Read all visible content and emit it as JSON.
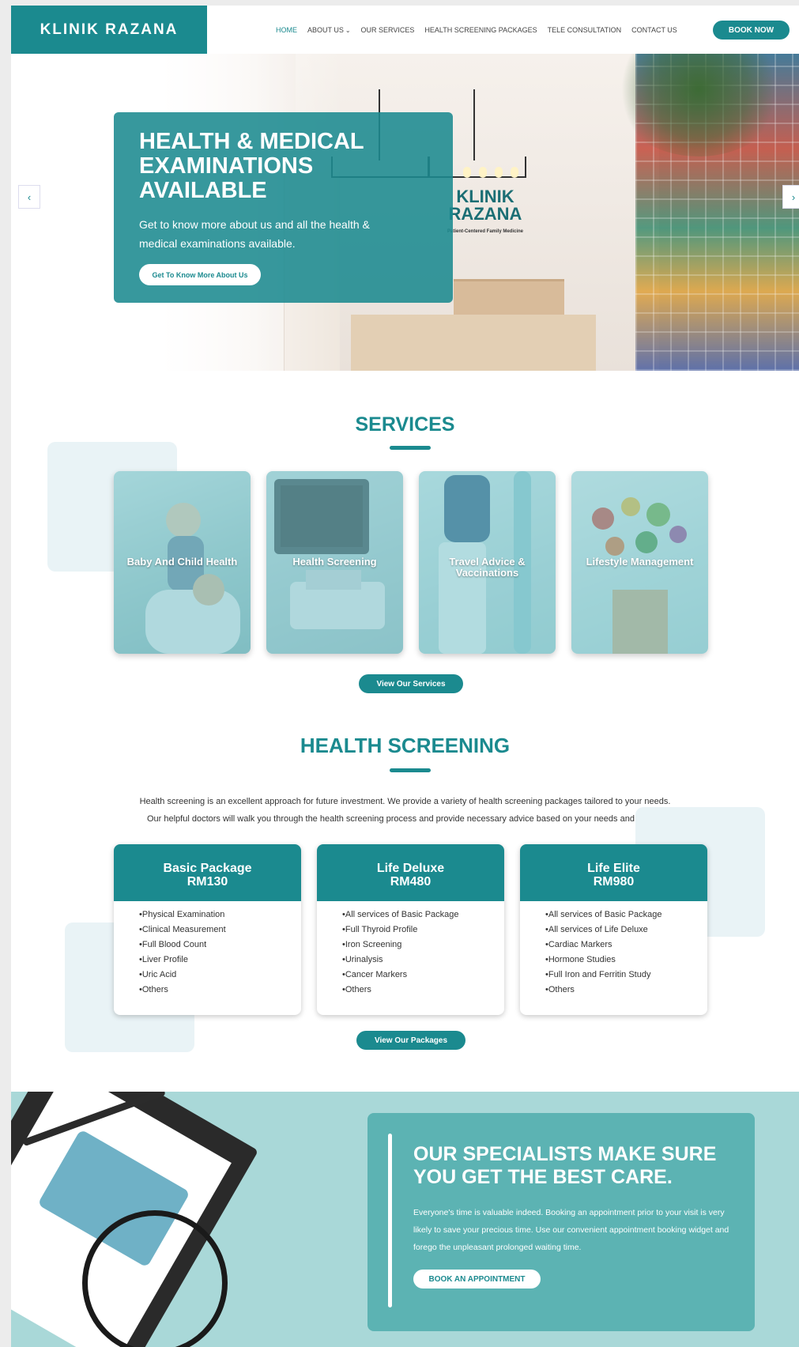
{
  "header": {
    "logo": "KLINIK RAZANA",
    "nav": [
      {
        "label": "HOME",
        "active": true
      },
      {
        "label": "ABOUT US",
        "has_dropdown": true
      },
      {
        "label": "OUR SERVICES"
      },
      {
        "label": "HEALTH SCREENING PACKAGES"
      },
      {
        "label": "TELE CONSULTATION"
      },
      {
        "label": "CONTACT US"
      }
    ],
    "book_now": "BOOK NOW"
  },
  "hero": {
    "title": "HEALTH & MEDICAL EXAMINATIONS AVAILABLE",
    "description": "Get to know more about us and all the health & medical examinations available.",
    "button": "Get To Know More About Us",
    "sign_title": "KLINIK RAZANA",
    "sign_subtitle": "Patient-Centered Family Medicine",
    "prev_icon": "chevron-left-icon",
    "next_icon": "chevron-right-icon"
  },
  "services": {
    "title": "SERVICES",
    "cards": [
      {
        "label": "Baby And Child Health"
      },
      {
        "label": "Health Screening"
      },
      {
        "label": "Travel Advice & Vaccinations"
      },
      {
        "label": "Lifestyle Management"
      }
    ],
    "button": "View Our Services"
  },
  "health_screening": {
    "title": "HEALTH SCREENING",
    "intro_line1": "Health screening is an excellent approach for future investment. We provide a variety of health screening packages tailored to your needs.",
    "intro_line2": "Our helpful doctors will walk you through the health screening process and provide necessary advice based on your needs and health.",
    "packages": [
      {
        "name": "Basic Package",
        "price": "RM130",
        "items": [
          "Physical Examination",
          "Clinical Measurement",
          "Full Blood Count",
          "Liver Profile",
          "Uric Acid",
          "Others"
        ]
      },
      {
        "name": "Life Deluxe",
        "price": "RM480",
        "items": [
          "All services of Basic Package",
          "Full Thyroid Profile",
          "Iron Screening",
          "Urinalysis",
          "Cancer Markers",
          "Others"
        ]
      },
      {
        "name": "Life Elite",
        "price": "RM980",
        "items": [
          "All services of Basic Package",
          "All services of Life Deluxe",
          "Cardiac Markers",
          "Hormone Studies",
          "Full Iron and Ferritin Study",
          "Others"
        ]
      }
    ],
    "button": "View Our Packages"
  },
  "cta": {
    "title": "OUR SPECIALISTS MAKE SURE YOU GET THE BEST CARE.",
    "description": "Everyone's time is valuable indeed. Booking an appointment prior to your visit is very likely to save your precious time. Use our convenient appointment booking widget and forego the unpleasant prolonged waiting time.",
    "button": "BOOK AN APPOINTMENT"
  },
  "colors": {
    "brand": "#1b8a8f",
    "cta_card": "#5cb3b3",
    "cta_bg": "#a9d8d8"
  }
}
